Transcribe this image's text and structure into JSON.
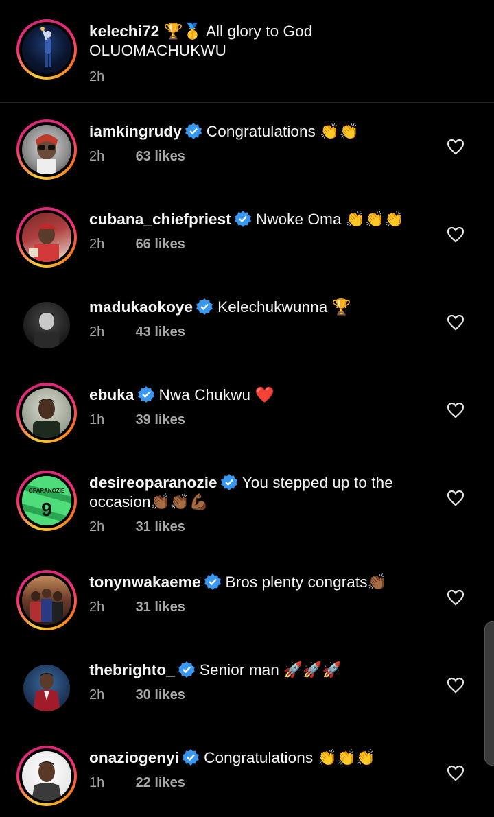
{
  "caption": {
    "username": "kelechi72",
    "emojis": "🏆🥇",
    "text_line1": "All glory to God",
    "text_line2": "OLUOMACHUKWU",
    "time": "2h"
  },
  "comments": [
    {
      "username": "iamkingrudy",
      "text": "Congratulations",
      "emojis": "👏👏",
      "time": "2h",
      "likes": "63 likes",
      "avatar_icon": "sunglasses-man-avatar"
    },
    {
      "username": "cubana_chiefpriest",
      "text": "Nwoke Oma",
      "emojis": "👏👏👏",
      "time": "2h",
      "likes": "66 likes",
      "avatar_icon": "red-cap-man-avatar"
    },
    {
      "username": "madukaokoye",
      "text": "Kelechukwunna",
      "emojis": "🏆",
      "time": "2h",
      "likes": "43 likes",
      "avatar_icon": "man-portrait-avatar"
    },
    {
      "username": "ebuka",
      "text": "Nwa Chukwu",
      "emojis": "❤️",
      "time": "1h",
      "likes": "39 likes",
      "avatar_icon": "man-portrait-avatar"
    },
    {
      "username": "desireoparanozie",
      "text": "You stepped up to the",
      "text_line2": "occasion",
      "emojis": "👏🏾👏🏾💪🏾",
      "time": "2h",
      "likes": "31 likes",
      "avatar_icon": "green-jersey-avatar",
      "jersey_name": "OPARANOZIE",
      "jersey_number": "9"
    },
    {
      "username": "tonynwakaeme",
      "text": "Bros plenty congrats",
      "emojis": "👏🏾",
      "time": "2h",
      "likes": "31 likes",
      "avatar_icon": "group-photo-avatar"
    },
    {
      "username": "thebrighto_",
      "text": "Senior man",
      "emojis": "🚀🚀🚀",
      "time": "2h",
      "likes": "30 likes",
      "avatar_icon": "red-suit-man-avatar"
    },
    {
      "username": "onaziogenyi",
      "text": "Congratulations",
      "emojis": "👏👏👏",
      "time": "1h",
      "likes": "22 likes",
      "avatar_icon": "man-portrait-avatar"
    }
  ],
  "colors": {
    "background": "#000000",
    "text": "#f5f5f5",
    "secondary_text": "#a8a8a8",
    "verified_badge": "#3897f0"
  }
}
